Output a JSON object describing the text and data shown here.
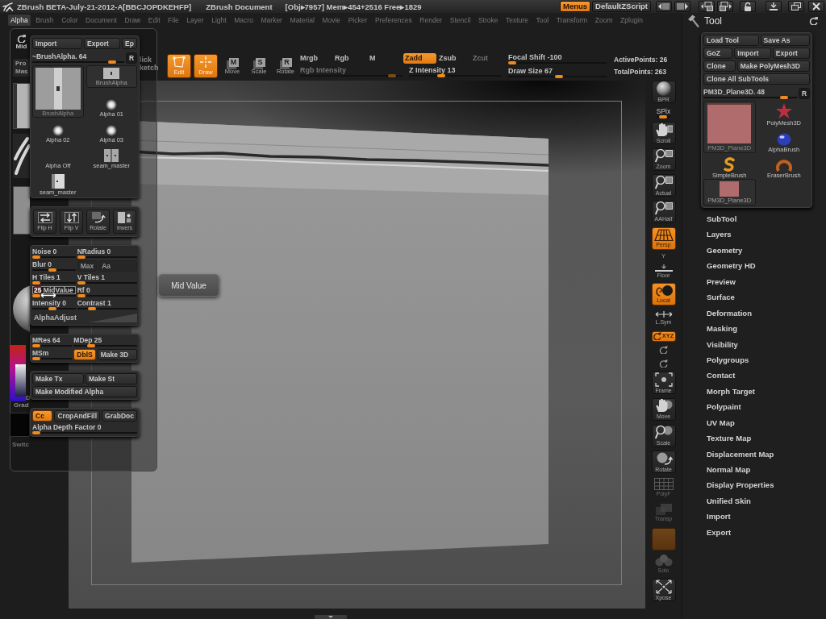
{
  "title_bar": {
    "app_title": "ZBrush BETA-July-21-2012-A[BBCJOPDKEHFP]",
    "document_title": "ZBrush Document",
    "memory_stats": "[Obj▸7957] Mem▸454+2516 Free▸1829",
    "buttons": [
      {
        "label": "Menus",
        "selected": true
      },
      {
        "label": "DefaultZScript",
        "selected": false
      }
    ]
  },
  "menu_bar": [
    {
      "label": "Alpha",
      "selected": true
    },
    {
      "label": "Brush",
      "selected": false
    },
    {
      "label": "Color",
      "selected": false
    },
    {
      "label": "Document",
      "selected": false
    },
    {
      "label": "Draw",
      "selected": false
    },
    {
      "label": "Edit",
      "selected": false
    },
    {
      "label": "File",
      "selected": false
    },
    {
      "label": "Layer",
      "selected": false
    },
    {
      "label": "Light",
      "selected": false
    },
    {
      "label": "Macro",
      "selected": false
    },
    {
      "label": "Marker",
      "selected": false
    },
    {
      "label": "Material",
      "selected": false
    },
    {
      "label": "Movie",
      "selected": false
    },
    {
      "label": "Picker",
      "selected": false
    },
    {
      "label": "Preferences",
      "selected": false
    },
    {
      "label": "Render",
      "selected": false
    },
    {
      "label": "Stencil",
      "selected": false
    },
    {
      "label": "Stroke",
      "selected": false
    },
    {
      "label": "Texture",
      "selected": false
    },
    {
      "label": "Tool",
      "selected": false
    },
    {
      "label": "Transform",
      "selected": false
    },
    {
      "label": "Zoom",
      "selected": false
    },
    {
      "label": "Zplugin",
      "selected": false
    }
  ],
  "left_shelf": {
    "mid_button": "Mid",
    "cut_button_lines": [
      "Pro",
      "Mas"
    ],
    "color_label": "D",
    "gradient_label": "Grad",
    "switch_label": "Switc"
  },
  "top_shelf": {
    "cut_labels": [
      "lick",
      "ketch"
    ],
    "tools": [
      {
        "label": "Edit",
        "kind": "edit",
        "on": true
      },
      {
        "label": "Draw",
        "kind": "draw",
        "on": true
      },
      {
        "label": "Move",
        "kind": "letter",
        "icon_letter": "M",
        "on": false
      },
      {
        "label": "Scale",
        "kind": "letter",
        "icon_letter": "S",
        "on": false
      },
      {
        "label": "Rotate",
        "kind": "letter",
        "icon_letter": "R",
        "on": false
      }
    ],
    "color_modes": [
      {
        "label": "Mrgb",
        "on": false
      },
      {
        "label": "Rgb",
        "on": false
      },
      {
        "label": "M",
        "on": false
      }
    ],
    "rgb_intensity": {
      "label": "Rgb Intensity",
      "disabled": true,
      "level": 0.93
    },
    "z_modes": [
      {
        "label": "Zadd",
        "on": true,
        "disabled": false
      },
      {
        "label": "Zsub",
        "on": false,
        "disabled": false
      },
      {
        "label": "Zcut",
        "on": false,
        "disabled": true
      }
    ],
    "z_intensity": {
      "label": "Z Intensity",
      "value": "13",
      "level": 0.33
    },
    "focal_shift": {
      "label": "Focal Shift",
      "value": "-100",
      "level": 0
    },
    "draw_size": {
      "label": "Draw Size",
      "value": "67",
      "level": 0.52
    },
    "stats": [
      "ActivePoints: 26",
      "TotalPoints: 263"
    ]
  },
  "alpha_popup": {
    "header_buttons": [
      "Import",
      "Export",
      "Ep"
    ],
    "alpha_slider": {
      "label": "~BrushAlpha.",
      "value": "64",
      "level": 0.9
    },
    "reset_button": "R",
    "thumbnails": [
      {
        "label": "BrushAlpha",
        "kind": "strip"
      },
      {
        "label": "BrushAlpha",
        "kind": "large"
      },
      {
        "label": "Alpha 01",
        "kind": "dot"
      },
      {
        "label": "Alpha 02",
        "kind": "dot"
      },
      {
        "label": "Alpha 03",
        "kind": "dot"
      },
      {
        "label": "Alpha Off",
        "kind": "none"
      },
      {
        "label": "seam_master",
        "kind": "seam"
      },
      {
        "label": "seam_master",
        "kind": "seam-light"
      }
    ],
    "transform_buttons": [
      {
        "label": "Flip H",
        "kind": "flip-h"
      },
      {
        "label": "Flip V",
        "kind": "flip-v"
      },
      {
        "label": "Rotate",
        "kind": "rotate"
      },
      {
        "label": "Invers",
        "kind": "invert"
      }
    ],
    "panels": [
      {
        "rows": [
          [
            {
              "kind": "slider",
              "label": "Noise",
              "value": "0",
              "level": 0,
              "editing": false
            },
            {
              "kind": "slider",
              "label": "NRadius",
              "value": "0",
              "level": 0,
              "editing": false
            }
          ],
          [
            {
              "kind": "slider",
              "label": "Blur",
              "value": "0",
              "level": 0.45,
              "editing": false
            },
            {
              "kind": "toggle",
              "label": "Max",
              "on": false
            },
            {
              "kind": "toggle",
              "label": "Aa",
              "on": false
            }
          ],
          [
            {
              "kind": "slider",
              "label": "H Tiles",
              "value": "1",
              "level": 0,
              "editing": false
            },
            {
              "kind": "slider",
              "label": "V Tiles",
              "value": "1",
              "level": 0,
              "editing": false
            }
          ],
          [
            {
              "kind": "slider",
              "label": "MidValue",
              "value": "25",
              "level": 0,
              "editing": true
            },
            {
              "kind": "slider",
              "label": "Rf",
              "value": "0",
              "level": 0,
              "editing": false
            }
          ],
          [
            {
              "kind": "slider",
              "label": "Intensity",
              "value": "0",
              "level": 0.45,
              "editing": false
            },
            {
              "kind": "slider",
              "label": "Contrast",
              "value": "1",
              "level": 0.2,
              "editing": false
            }
          ],
          [
            {
              "kind": "curve",
              "label": "AlphaAdjust"
            }
          ]
        ]
      },
      {
        "rows": [
          [
            {
              "kind": "slider",
              "label": "MRes",
              "value": "64",
              "level": 0,
              "editing": false
            },
            {
              "kind": "slider",
              "label": "MDep",
              "value": "25",
              "level": 0.25,
              "editing": false
            }
          ],
          [
            {
              "kind": "slider",
              "label": "MSm",
              "level": 0,
              "editing": false
            },
            {
              "kind": "toggle",
              "label": "DblS",
              "on": true
            },
            {
              "kind": "button",
              "label": "Make 3D"
            }
          ]
        ]
      },
      {
        "rows": [
          [
            {
              "kind": "button",
              "label": "Make Tx"
            },
            {
              "kind": "button",
              "label": "Make St"
            }
          ],
          [
            {
              "kind": "button",
              "label": "Make Modified Alpha"
            }
          ]
        ]
      },
      {
        "rows": [
          [
            {
              "kind": "toggle",
              "label": "Cc",
              "on": true
            },
            {
              "kind": "button",
              "label": "CropAndFill"
            },
            {
              "kind": "button",
              "label": "GrabDoc"
            }
          ],
          [
            {
              "kind": "slider",
              "label": "Alpha Depth Factor",
              "value": "0",
              "level": 0,
              "editing": false
            }
          ]
        ]
      }
    ]
  },
  "tooltip": "Mid Value",
  "right_shelf": [
    {
      "kind": "sphere",
      "label": "BPR",
      "on": false,
      "disabled": false
    },
    {
      "kind": "slider",
      "label": "SPix",
      "level": 0.4,
      "on": false,
      "disabled": false
    },
    {
      "kind": "hand",
      "label": "Scroll",
      "on": false,
      "disabled": false
    },
    {
      "kind": "magnifier",
      "label": "Zoom",
      "on": false,
      "disabled": false
    },
    {
      "kind": "magnifier",
      "label": "Actual",
      "on": false,
      "disabled": false
    },
    {
      "kind": "magnifier",
      "label": "AAHalf",
      "on": false,
      "disabled": false
    },
    {
      "kind": "perspective",
      "label": "Persp",
      "on": true,
      "disabled": false
    },
    {
      "kind": "caption",
      "label": "Y",
      "on": false,
      "disabled": false
    },
    {
      "kind": "floor",
      "label": "Floor",
      "on": false,
      "disabled": false
    },
    {
      "kind": "local",
      "label": "Local",
      "on": true,
      "disabled": false
    },
    {
      "kind": "symmetry",
      "label": "L.Sym",
      "on": false,
      "disabled": false
    },
    {
      "kind": "axis",
      "label": "XYZ",
      "on": true,
      "disabled": false
    },
    {
      "kind": "spin",
      "on": false,
      "disabled": false
    },
    {
      "kind": "spin",
      "on": false,
      "disabled": false
    },
    {
      "kind": "frame",
      "label": "Frame",
      "on": false,
      "disabled": false
    },
    {
      "kind": "move",
      "label": "Move",
      "on": false,
      "disabled": false
    },
    {
      "kind": "scale",
      "label": "Scale",
      "on": false,
      "disabled": false
    },
    {
      "kind": "rotate",
      "label": "Rotate",
      "on": false,
      "disabled": false
    },
    {
      "kind": "polyframe",
      "label": "PolyF",
      "on": false,
      "disabled": true
    },
    {
      "kind": "transparency",
      "label": "Transp",
      "on": false,
      "disabled": true
    },
    {
      "kind": "tile",
      "on": true,
      "disabled": true
    },
    {
      "kind": "solo",
      "label": "Solo",
      "on": false,
      "disabled": true
    },
    {
      "kind": "xpose",
      "label": "Xpose",
      "on": false,
      "disabled": false
    }
  ],
  "tool_panel": {
    "title": "Tool",
    "button_rows": [
      [
        "Load Tool",
        "Save As"
      ],
      [
        "GoZ",
        "Import",
        "Export"
      ],
      [
        "Clone",
        "Make PolyMesh3D"
      ],
      [
        "Clone All SubTools"
      ]
    ],
    "tool_slider": {
      "label": "PM3D_Plane3D.",
      "value": "48",
      "level": 0.9
    },
    "reset_button": "R",
    "tools": [
      {
        "label": "PolyMesh3D",
        "kind": "star"
      },
      {
        "label": "PM3D_Plane3D",
        "kind": "large-plane"
      },
      {
        "label": "AlphaBrush",
        "kind": "blob"
      },
      {
        "label": "SimpleBrush",
        "kind": "s-curve"
      },
      {
        "label": "EraserBrush",
        "kind": "crescent"
      },
      {
        "label": "PM3D_Plane3D",
        "kind": "plane"
      }
    ],
    "sections": [
      "SubTool",
      "Layers",
      "Geometry",
      "Geometry HD",
      "Preview",
      "Surface",
      "Deformation",
      "Masking",
      "Visibility",
      "Polygroups",
      "Contact",
      "Morph Target",
      "Polypaint",
      "UV Map",
      "Texture Map",
      "Displacement Map",
      "Normal Map",
      "Display Properties",
      "Unified Skin",
      "Import",
      "Export"
    ]
  }
}
